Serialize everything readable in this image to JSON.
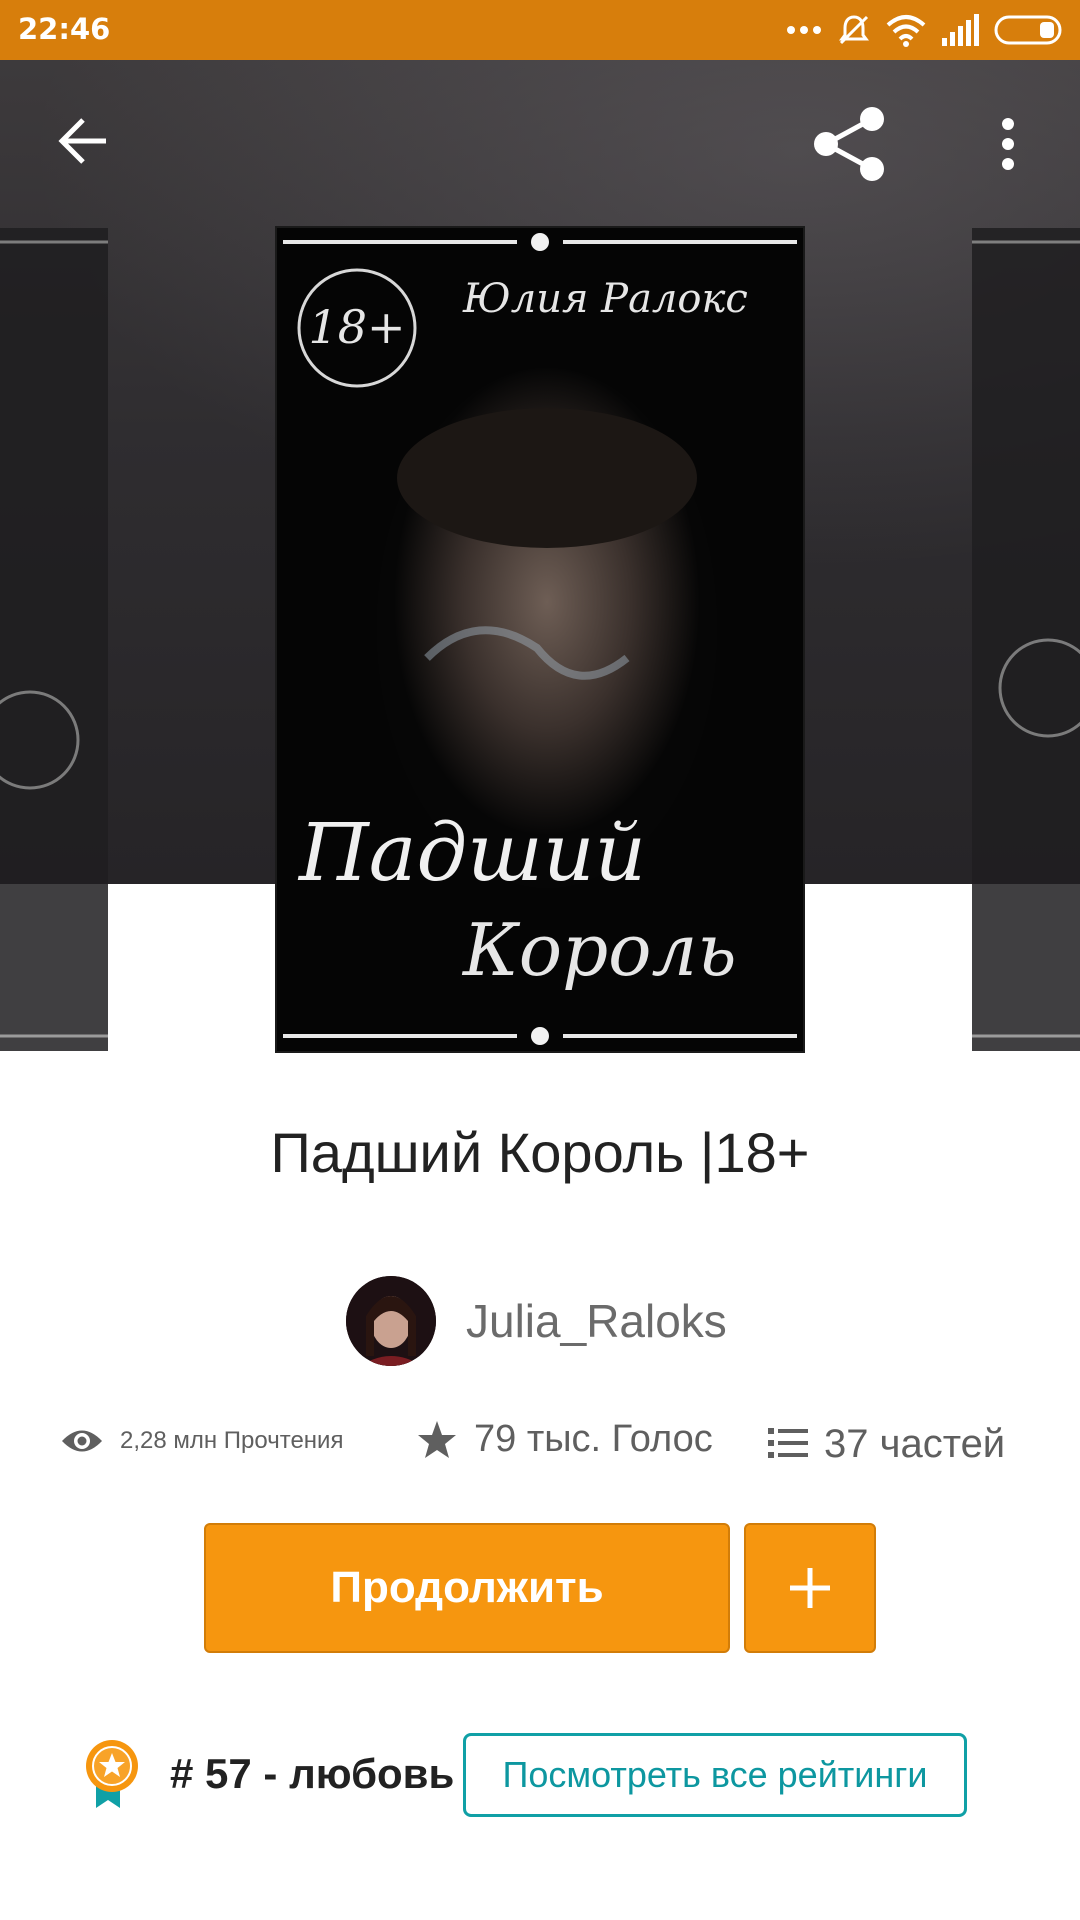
{
  "status_bar": {
    "time": "22:46",
    "icons": [
      "more-dots-icon",
      "mute-icon",
      "wifi-icon",
      "signal-icon",
      "battery-icon"
    ]
  },
  "toolbar": {
    "back_icon": "arrow-left-icon",
    "share_icon": "share-icon",
    "menu_icon": "more-vert-icon"
  },
  "cover": {
    "age_badge": "18+",
    "author_script": "Юлия Ралокс",
    "title_line1": "Падший",
    "title_line2": "Король"
  },
  "story": {
    "title": "Падший Король |18+",
    "author": "Julia_Raloks"
  },
  "stats": {
    "reads": "2,28 млн Прочтения",
    "votes": "79 тыс. Голос",
    "parts": "37 частей"
  },
  "actions": {
    "continue_label": "Продолжить",
    "add_label": "+"
  },
  "ranking": {
    "text": "# 57 - любовь",
    "view_all_label": "Посмотреть все рейтинги"
  },
  "colors": {
    "status_bar": "#d77e0c",
    "accent_orange": "#f6960f",
    "teal": "#10a0a6"
  }
}
